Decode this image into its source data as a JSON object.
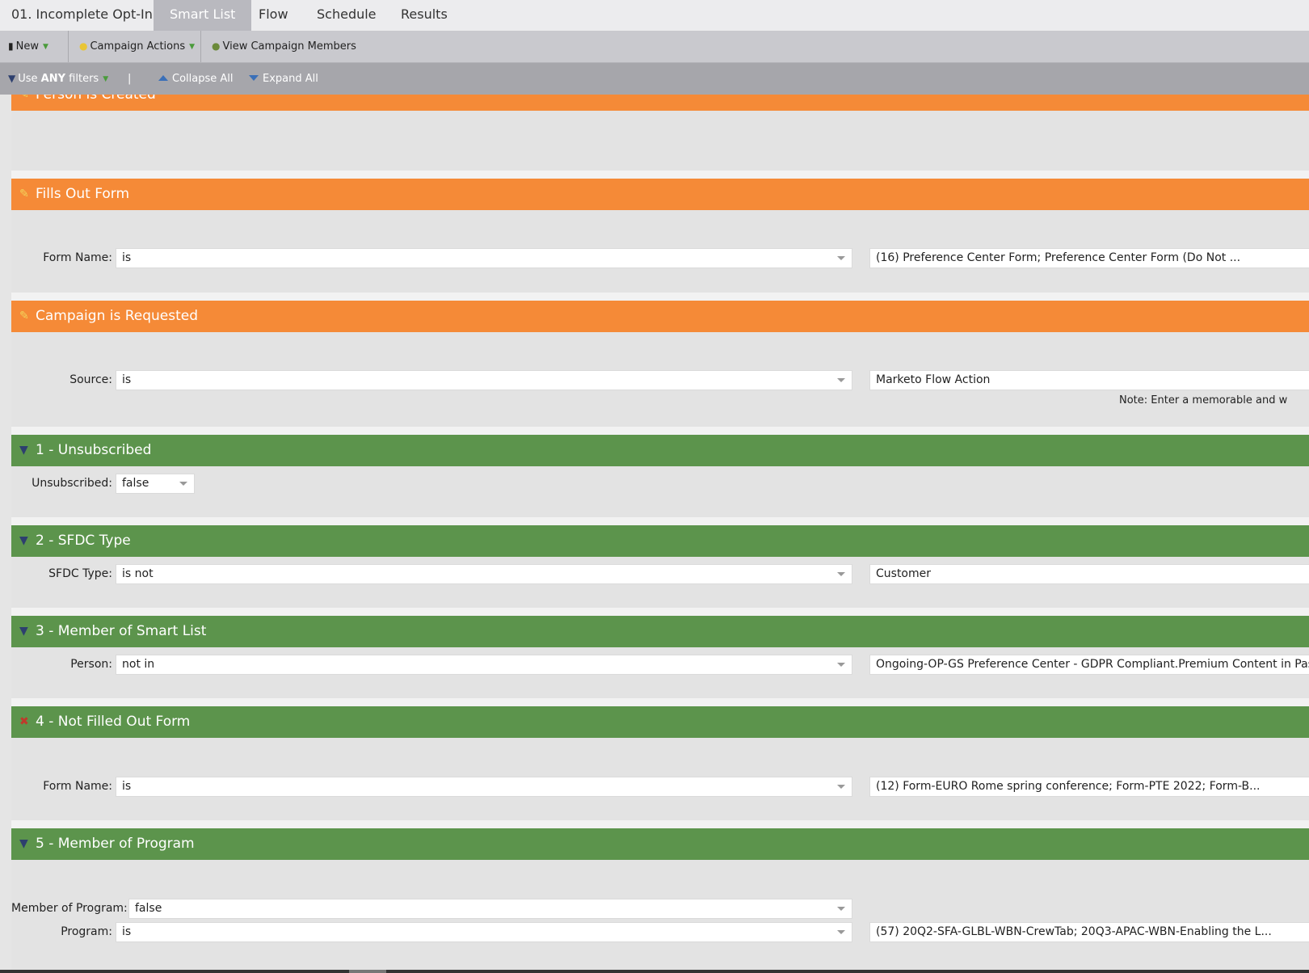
{
  "tabs": {
    "title": "01. Incomplete Opt-In",
    "smart_list": "Smart List",
    "flow": "Flow",
    "schedule": "Schedule",
    "results": "Results"
  },
  "toolbar": {
    "new": "New",
    "campaign_actions": "Campaign Actions",
    "view_members": "View Campaign Members"
  },
  "filter_bar": {
    "use": "Use",
    "any": "ANY",
    "filters": "filters",
    "pipe": "|",
    "collapse_all": "Collapse All",
    "expand_all": "Expand All"
  },
  "triggers": [
    {
      "title": "Person is Created"
    },
    {
      "title": "Fills Out Form",
      "label": "Form Name:",
      "operator": "is",
      "value": "(16) Preference Center Form; Preference Center Form (Do Not ..."
    },
    {
      "title": "Campaign is Requested",
      "label": "Source:",
      "operator": "is",
      "value": "Marketo Flow Action",
      "note": "Note: Enter a memorable and w"
    }
  ],
  "filters": [
    {
      "title": "1 - Unsubscribed",
      "label": "Unsubscribed:",
      "operator": "false"
    },
    {
      "title": "2 - SFDC Type",
      "label": "SFDC Type:",
      "operator": "is not",
      "value": "Customer"
    },
    {
      "title": "3 - Member of Smart List",
      "label": "Person:",
      "operator": "not in",
      "value": "Ongoing-OP-GS Preference Center - GDPR Compliant.Premium Content in Past"
    },
    {
      "title": "4 - Not Filled Out Form",
      "label": "Form Name:",
      "operator": "is",
      "value": "(12) Form-EURO Rome spring conference; Form-PTE 2022; Form-B..."
    },
    {
      "title": "5 - Member of Program",
      "label": "Member of Program:",
      "operator": "false",
      "label2": "Program:",
      "operator2": "is",
      "value2": "(57) 20Q2-SFA-GLBL-WBN-CrewTab; 20Q3-APAC-WBN-Enabling the L..."
    }
  ],
  "colors": {
    "trigger_header": "#f58a37",
    "filter_header": "#5c944c"
  },
  "icons": {
    "trigger": "lightning-pencil-icon",
    "filter": "filter-funnel-icon",
    "not_filter": "filter-x-icon"
  }
}
